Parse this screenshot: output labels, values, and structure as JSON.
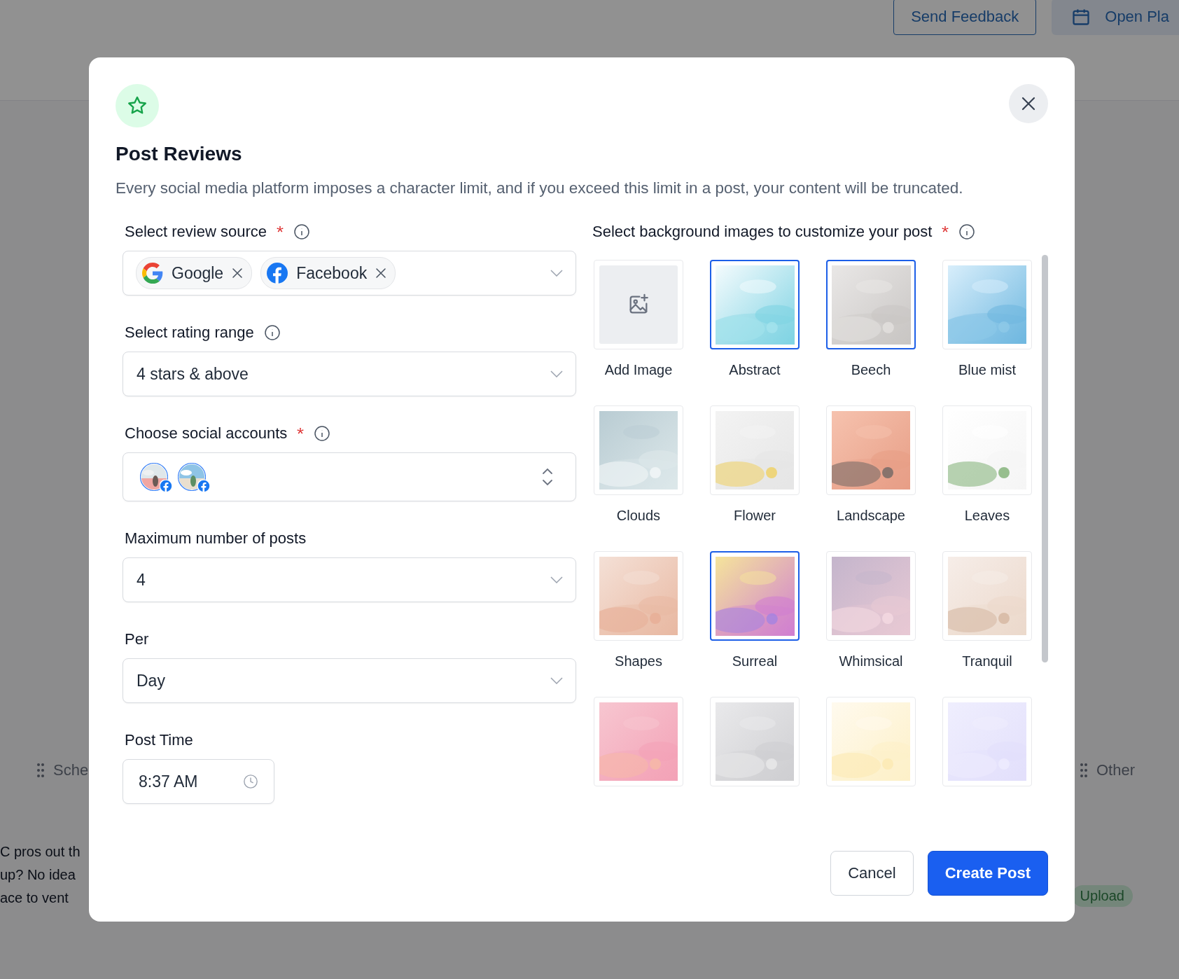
{
  "background": {
    "header_buttons": [
      {
        "label": "Send Feedback",
        "kind": "outline"
      },
      {
        "label": "Open Pla",
        "kind": "calendar"
      }
    ],
    "columns": [
      "Sche",
      "Other"
    ],
    "post_lines": [
      "C pros out th",
      "up? No idea",
      "ace to vent"
    ],
    "badge": "Upload"
  },
  "modal": {
    "title": "Post Reviews",
    "description": "Every social media platform imposes a character limit, and if you exceed this limit in a post, your content will be truncated.",
    "fields": [
      {
        "kind": "tags",
        "label": "Select review source",
        "required": true,
        "info": true,
        "tags": [
          {
            "label": "Google",
            "kind": "google"
          },
          {
            "label": "Facebook",
            "kind": "facebook"
          }
        ]
      },
      {
        "kind": "select",
        "label": "Select rating range",
        "required": false,
        "info": true,
        "value": "4 stars & above"
      },
      {
        "kind": "accounts",
        "label": "Choose social accounts",
        "required": true,
        "info": true,
        "accounts": [
          {
            "kind": "picture"
          },
          {
            "kind": "picture"
          }
        ]
      },
      {
        "kind": "select",
        "label": "Maximum number of posts",
        "required": false,
        "info": false,
        "value": "4"
      },
      {
        "kind": "select",
        "label": "Per",
        "required": false,
        "info": false,
        "value": "Day"
      },
      {
        "kind": "time",
        "label": "Post Time",
        "required": false,
        "info": false,
        "value": "8:37 AM"
      }
    ],
    "images": {
      "label": "Select background images to customize your post",
      "required": true,
      "info": true,
      "tiles": [
        {
          "kind": "add",
          "label": "Add Image",
          "selected": false
        },
        {
          "kind": "picture",
          "label": "Abstract",
          "selected": true
        },
        {
          "kind": "picture",
          "label": "Beech",
          "selected": true
        },
        {
          "kind": "picture",
          "label": "Blue mist",
          "selected": false
        },
        {
          "kind": "picture",
          "label": "Clouds",
          "selected": false
        },
        {
          "kind": "picture",
          "label": "Flower",
          "selected": false
        },
        {
          "kind": "picture",
          "label": "Landscape",
          "selected": false
        },
        {
          "kind": "picture",
          "label": "Leaves",
          "selected": false
        },
        {
          "kind": "picture",
          "label": "Shapes",
          "selected": false
        },
        {
          "kind": "picture",
          "label": "Surreal",
          "selected": true
        },
        {
          "kind": "picture",
          "label": "Whimsical",
          "selected": false
        },
        {
          "kind": "picture",
          "label": "Tranquil",
          "selected": false
        },
        {
          "kind": "picture",
          "selected": false
        },
        {
          "kind": "picture",
          "selected": false
        },
        {
          "kind": "picture",
          "selected": false
        },
        {
          "kind": "picture",
          "selected": false
        }
      ]
    },
    "buttons": [
      {
        "label": "Cancel",
        "kind": "secondary"
      },
      {
        "label": "Create Post",
        "kind": "primary"
      }
    ]
  }
}
